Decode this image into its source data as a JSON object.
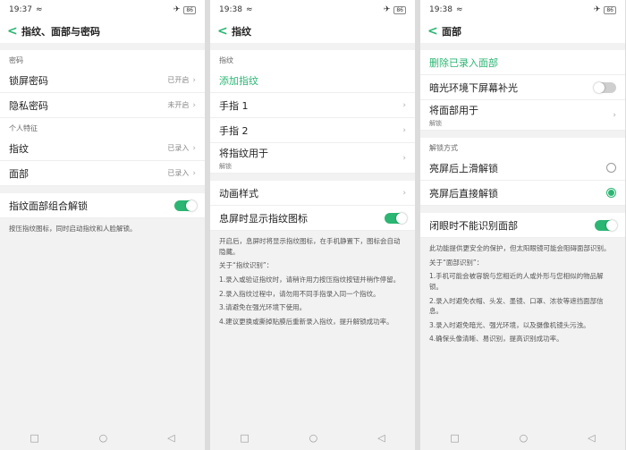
{
  "p1": {
    "time": "19:37",
    "battery": "86",
    "title": "指纹、面部与密码",
    "sec_password": "密码",
    "lock_pwd": "锁屏密码",
    "lock_pwd_val": "已开启",
    "privacy_pwd": "隐私密码",
    "privacy_pwd_val": "未开启",
    "sec_biometric": "个人特征",
    "fingerprint": "指纹",
    "fingerprint_val": "已录入",
    "face": "面部",
    "face_val": "已录入",
    "combo_unlock": "指纹面部组合解锁",
    "combo_note": "按压指纹图标，同时启动指纹和人脸解锁。"
  },
  "p2": {
    "time": "19:38",
    "battery": "86",
    "title": "指纹",
    "sec_fp": "指纹",
    "add_fp": "添加指纹",
    "finger1": "手指 1",
    "finger2": "手指 2",
    "use_for": "将指纹用于",
    "use_for_sub": "解锁",
    "anim": "动画样式",
    "screen_off_icon": "息屏时显示指纹图标",
    "note1": "开启后，息屏时将显示指纹图标，在手机静置下，图标会自动隐藏。",
    "note_title": "关于“指纹识别”：",
    "note2": "1.录入或验证指纹时，请稍许用力按压指纹按钮并稍作停留。",
    "note3": "2.录入指纹过程中，请勿用不同手指录入同一个指纹。",
    "note4": "3.请避免在强光环境下使用。",
    "note5": "4.建议更换或撕掉贴膜后重新录入指纹，提升解锁成功率。"
  },
  "p3": {
    "time": "19:38",
    "battery": "86",
    "title": "面部",
    "delete_face": "删除已录入面部",
    "low_light": "暗光环境下屏幕补光",
    "use_for": "将面部用于",
    "use_for_sub": "解锁",
    "sec_unlock": "解锁方式",
    "swipe_unlock": "亮屏后上滑解锁",
    "direct_unlock": "亮屏后直接解锁",
    "eyes_closed": "闭眼时不能识别面部",
    "note1": "此功能提供更安全的保护，但太阳眼镜可能会阻碍面部识别。",
    "note_title": "关于“面部识别”：",
    "note2": "1.手机可能会被容貌与您相近的人或外形与您相似的物品解锁。",
    "note3": "2.录入时避免衣帽、头发、墨镜、口罩、浓妆等遮挡面部信息。",
    "note4": "3.录入时避免暗光、强光环境，以及摄像机镜头污浊。",
    "note5": "4.确保头像清晰、易识别，提高识别成功率。"
  },
  "colors": {
    "accent": "#2bb673"
  }
}
